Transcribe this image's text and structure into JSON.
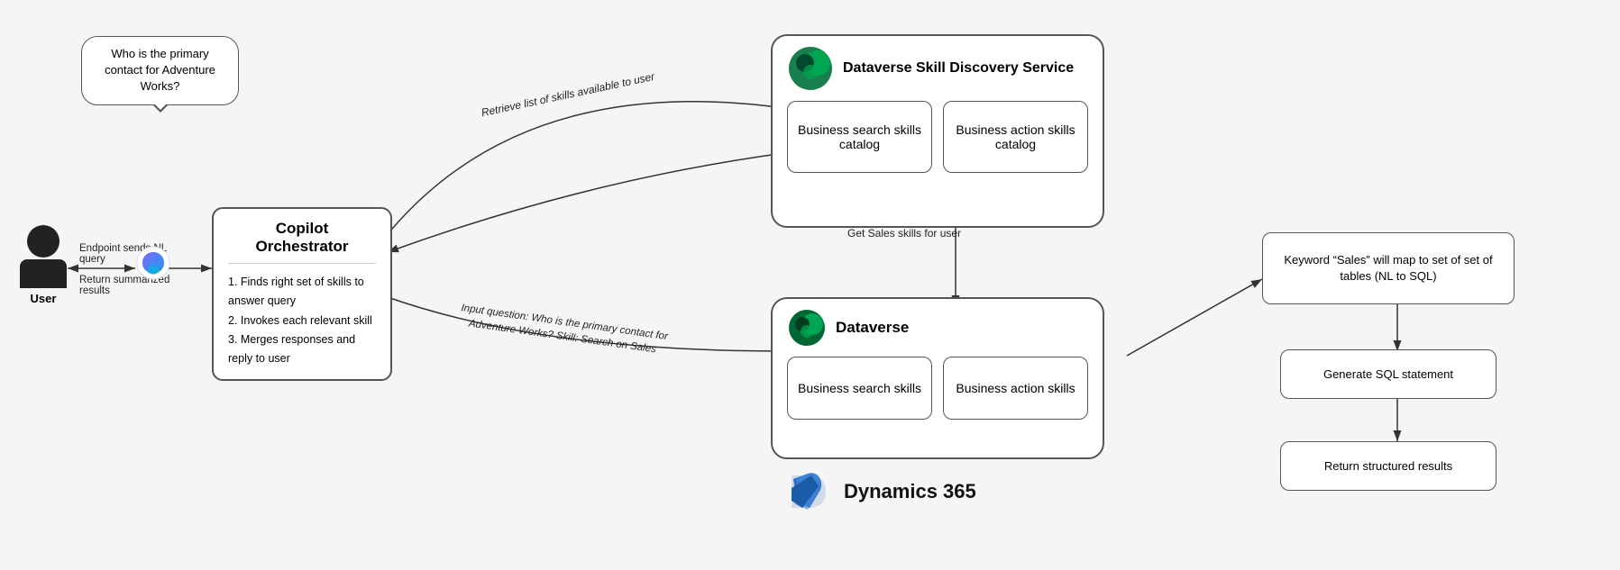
{
  "speech_bubble": {
    "text": "Who is the primary contact for Adventure Works?"
  },
  "user_label": "User",
  "copilot": {
    "title": "Copilot Orchestrator",
    "steps": [
      "1.  Finds right set of skills to answer query",
      "2.  Invokes each relevant skill",
      "3.  Merges responses and reply to user"
    ]
  },
  "endpoint_labels": {
    "sends": "Endpoint sends NL query",
    "return": "Return summarized results"
  },
  "dataverse_skill": {
    "title": "Dataverse Skill Discovery Service",
    "box1": "Business search skills catalog",
    "box2": "Business action skills catalog"
  },
  "dataverse": {
    "title": "Dataverse",
    "box1": "Business search skills",
    "box2": "Business action skills"
  },
  "dynamics": "Dynamics 365",
  "arrows": {
    "retrieve": "Retrieve list of skills available to user",
    "get_sales": "Get Sales skills for user",
    "input_question": "Input question: Who is the primary contact for Adventure Works?\nSkill: Search on Sales"
  },
  "right_side": {
    "box1": "Keyword “Sales” will map to set of set of tables (NL to SQL)",
    "box2": "Generate SQL statement",
    "box3": "Return structured results"
  }
}
